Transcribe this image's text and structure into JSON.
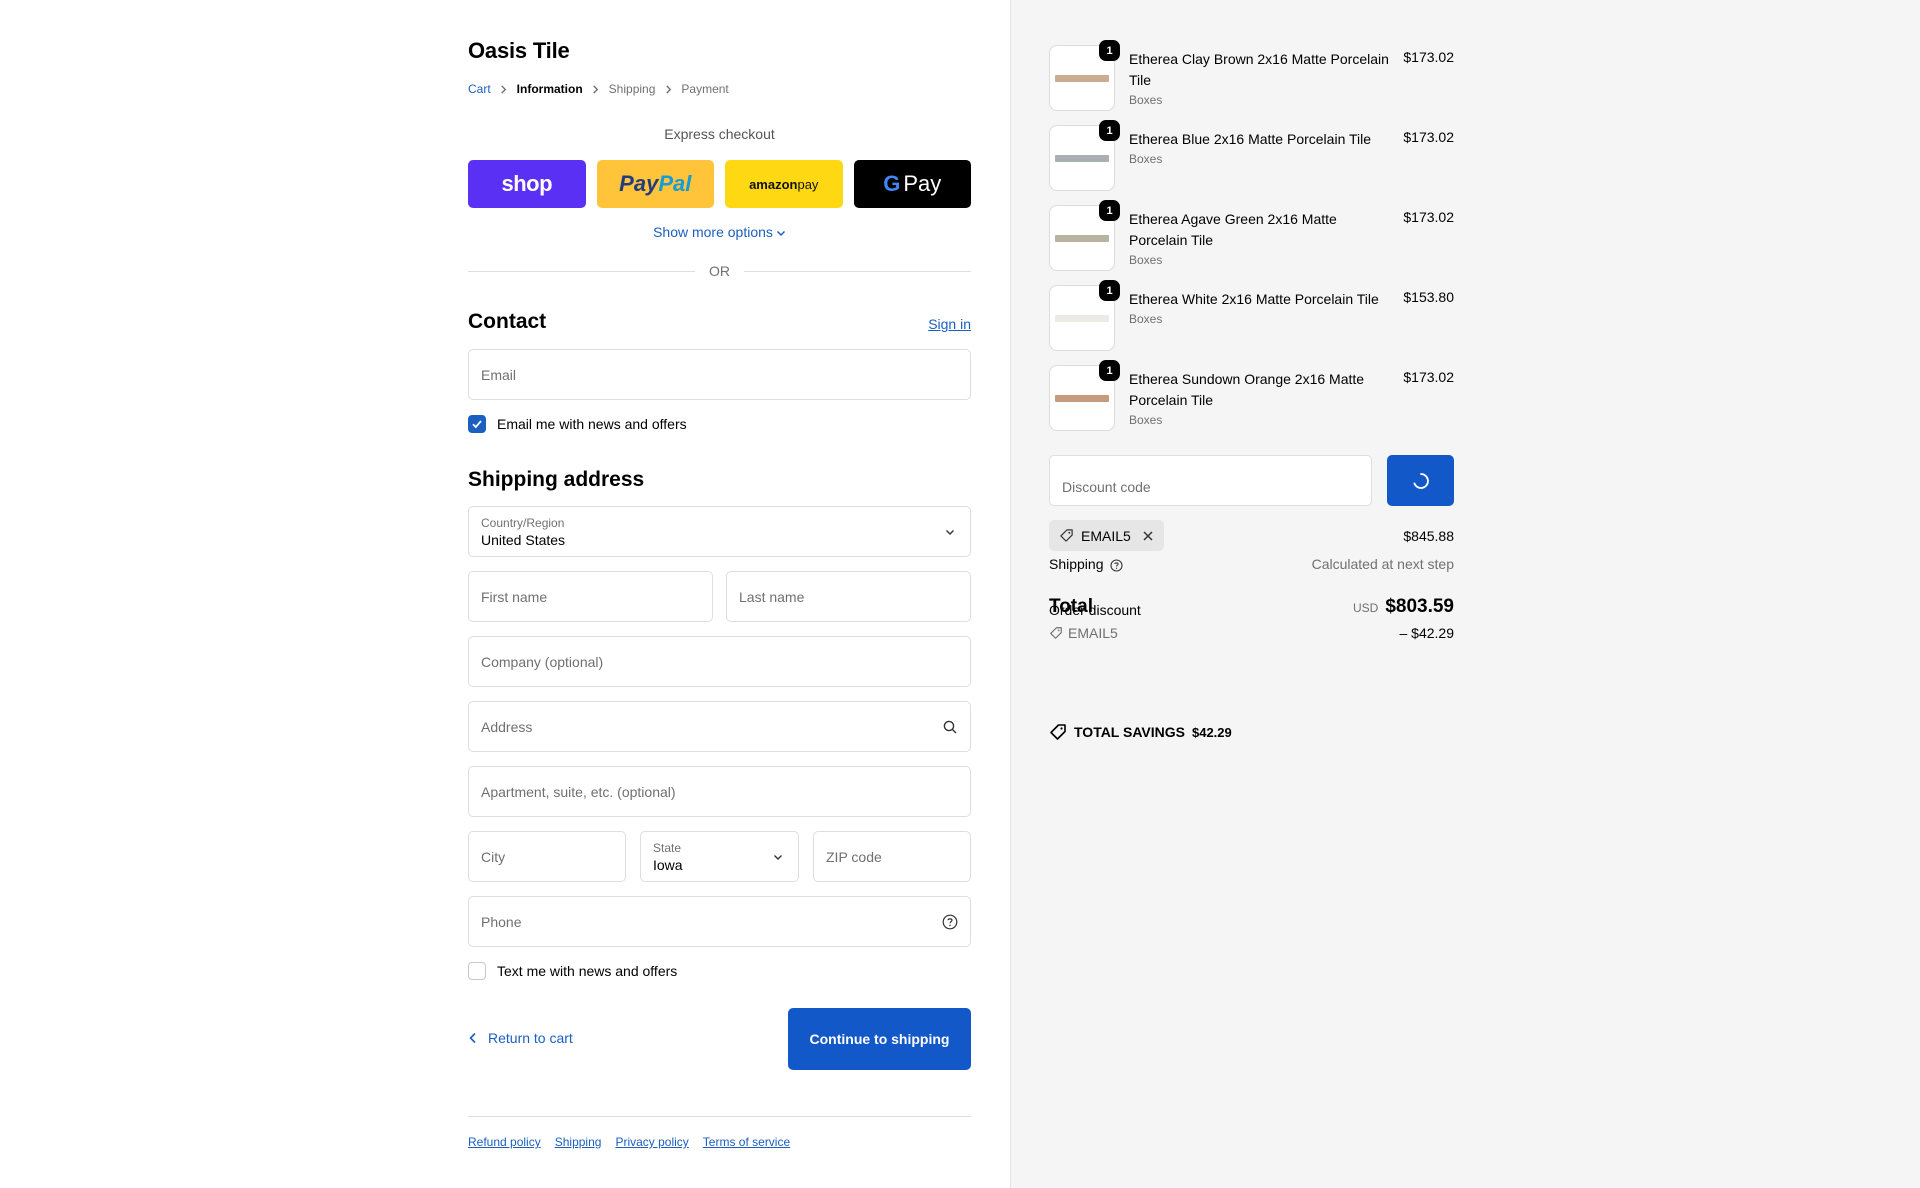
{
  "shop": {
    "name": "Oasis Tile"
  },
  "breadcrumb": [
    {
      "label": "Cart",
      "state": "link"
    },
    {
      "label": "Information",
      "state": "current"
    },
    {
      "label": "Shipping",
      "state": "upcoming"
    },
    {
      "label": "Payment",
      "state": "upcoming"
    }
  ],
  "express": {
    "title": "Express checkout",
    "buttons": {
      "shop": "shop",
      "paypal_a": "Pay",
      "paypal_b": "Pal",
      "amazon_a": "amazon",
      "amazon_b": " pay",
      "gpay_g": "G",
      "gpay": "Pay"
    },
    "show_more": "Show more options",
    "or": "OR"
  },
  "contact": {
    "title": "Contact",
    "sign_in": "Sign in",
    "email_placeholder": "Email",
    "news_checkbox": "Email me with news and offers",
    "news_checked": true
  },
  "shipping": {
    "title": "Shipping address",
    "country_label": "Country/Region",
    "country_value": "United States",
    "first_name": "First name",
    "last_name": "Last name",
    "company": "Company (optional)",
    "address": "Address",
    "apartment": "Apartment, suite, etc. (optional)",
    "city": "City",
    "state_label": "State",
    "state_value": "Iowa",
    "zip": "ZIP code",
    "phone": "Phone",
    "sms_checkbox": "Text me with news and offers",
    "sms_checked": false
  },
  "actions": {
    "return": "Return to cart",
    "continue": "Continue to shipping"
  },
  "footer": {
    "links": [
      "Refund policy",
      "Shipping",
      "Privacy policy",
      "Terms of service"
    ]
  },
  "summary": {
    "items": [
      {
        "name": "Etherea Clay Brown 2x16 Matte Porcelain Tile",
        "variant": "Boxes",
        "price": "$173.02",
        "qty": "1",
        "color": "#c9ad90"
      },
      {
        "name": "Etherea Blue 2x16 Matte Porcelain Tile",
        "variant": "Boxes",
        "price": "$173.02",
        "qty": "1",
        "color": "#a8b0b3"
      },
      {
        "name": "Etherea Agave Green 2x16 Matte Porcelain Tile",
        "variant": "Boxes",
        "price": "$173.02",
        "qty": "1",
        "color": "#b7b3a0"
      },
      {
        "name": "Etherea White 2x16 Matte Porcelain Tile",
        "variant": "Boxes",
        "price": "$153.80",
        "qty": "1",
        "color": "#ecebe3"
      },
      {
        "name": "Etherea Sundown Orange 2x16 Matte Porcelain Tile",
        "variant": "Boxes",
        "price": "$173.02",
        "qty": "1",
        "color": "#c69a7c"
      }
    ],
    "discount_placeholder": "Discount code",
    "applied_code": "EMAIL5",
    "subtotal": "$845.88",
    "shipping_label": "Shipping",
    "shipping_value": "Calculated at next step",
    "total_label": "Total",
    "order_discount_label": "Order discount",
    "currency": "USD",
    "total": "$803.59",
    "discount_code_line": "EMAIL5",
    "discount_amount": "– $42.29",
    "savings_label": "TOTAL SAVINGS",
    "savings_amount": "$42.29"
  },
  "colors": {
    "accent": "#1358c8",
    "link": "#1b5fc1",
    "shop_pay": "#5a31f4",
    "paypal": "#ffc439",
    "amazon": "#ffd814"
  }
}
